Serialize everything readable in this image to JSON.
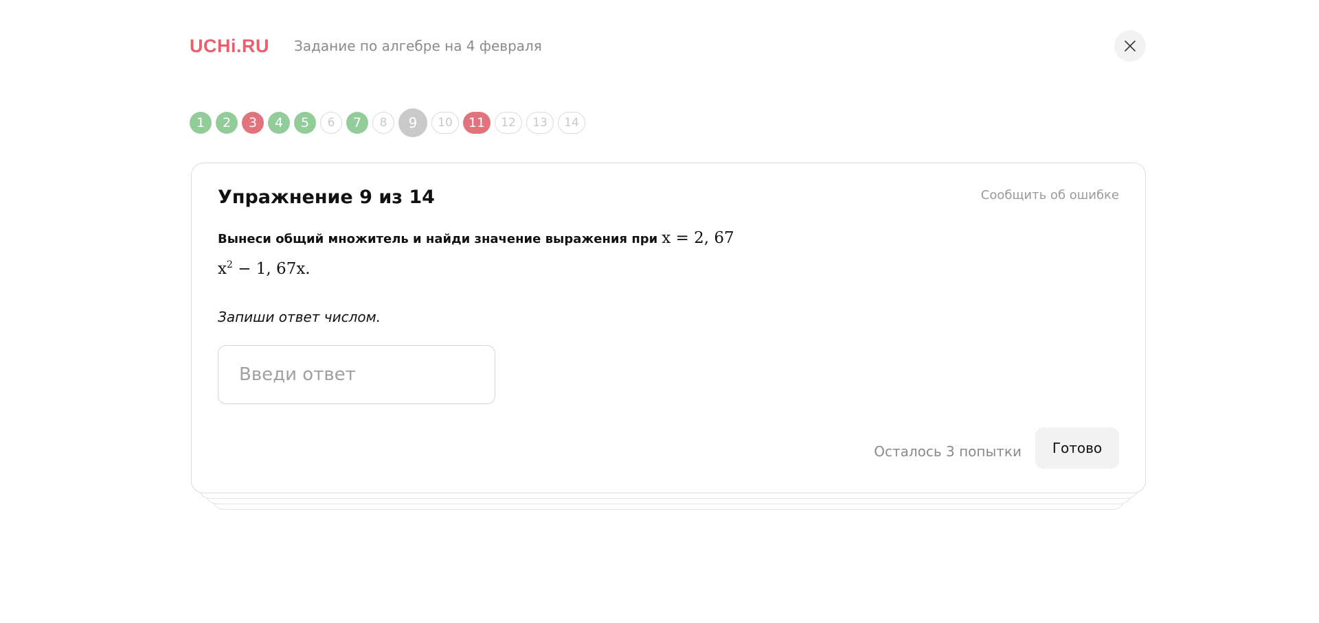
{
  "header": {
    "logo": "UCHi.RU",
    "title": "Задание по алгебре на 4 февраля"
  },
  "progress": {
    "items": [
      {
        "label": "1",
        "status": "correct"
      },
      {
        "label": "2",
        "status": "correct"
      },
      {
        "label": "3",
        "status": "wrong"
      },
      {
        "label": "4",
        "status": "correct"
      },
      {
        "label": "5",
        "status": "correct"
      },
      {
        "label": "6",
        "status": "empty"
      },
      {
        "label": "7",
        "status": "correct"
      },
      {
        "label": "8",
        "status": "empty"
      },
      {
        "label": "9",
        "status": "current"
      },
      {
        "label": "10",
        "status": "empty"
      },
      {
        "label": "11",
        "status": "wrong"
      },
      {
        "label": "12",
        "status": "empty"
      },
      {
        "label": "13",
        "status": "empty"
      },
      {
        "label": "14",
        "status": "empty"
      }
    ]
  },
  "card": {
    "title": "Упражнение 9 из 14",
    "report_link": "Сообщить об ошибке",
    "task_text": "Вынеси общий множитель и найди значение выражения при",
    "task_math": "x = 2, 67",
    "expression_base": "x",
    "expression_power": "2",
    "expression_rest": " − 1, 67x.",
    "hint": "Запиши ответ числом.",
    "input_placeholder": "Введи ответ",
    "input_value": "",
    "attempts": "Осталось 3 попытки",
    "submit_label": "Готово"
  },
  "colors": {
    "brand": "#e8606d",
    "correct": "#92cc98",
    "wrong": "#e0737b",
    "current": "#c9c9c9"
  },
  "icons": {
    "close": "close-icon"
  }
}
